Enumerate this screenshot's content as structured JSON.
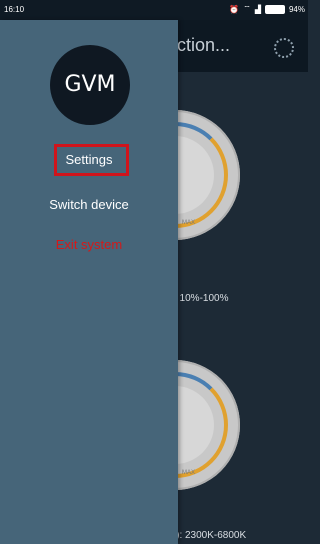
{
  "status_bar": {
    "time": "16:10",
    "battery": "94%"
  },
  "background": {
    "title": "ection...",
    "label1": ": 10%-100%",
    "label2": "T): 2300K-6800K",
    "dial_max": "MAX"
  },
  "drawer": {
    "avatar_text": "GVM",
    "items": [
      {
        "label": "Settings"
      },
      {
        "label": "Switch device"
      },
      {
        "label": "Exit system"
      }
    ],
    "colors": {
      "exit": "#d31a1a",
      "highlight": "#d0141c"
    }
  }
}
